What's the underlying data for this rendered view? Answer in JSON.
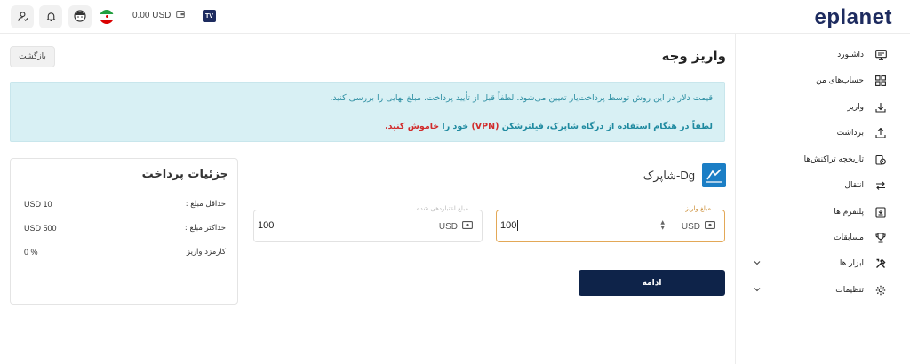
{
  "brand": {
    "logo": "eplanet"
  },
  "topbar": {
    "balance": "0.00 USD",
    "tv_label": "TV",
    "icons": [
      "tv-icon",
      "wallet-icon",
      "iran-flag-icon",
      "support-avatar-icon",
      "bell-icon",
      "user-icon"
    ]
  },
  "sidebar": {
    "items": [
      {
        "label": "داشبورد",
        "icon": "monitor-icon"
      },
      {
        "label": "حساب‌های من",
        "icon": "grid-icon"
      },
      {
        "label": "واریز",
        "icon": "download-icon"
      },
      {
        "label": "برداشت",
        "icon": "upload-icon"
      },
      {
        "label": "تاریخچه تراکنش‌ها",
        "icon": "history-icon"
      },
      {
        "label": "انتقال",
        "icon": "transfer-icon"
      },
      {
        "label": "پلتفرم ها",
        "icon": "platform-icon"
      },
      {
        "label": "مسابقات",
        "icon": "trophy-icon"
      },
      {
        "label": "ابزار ها",
        "icon": "tools-icon",
        "expandable": true
      },
      {
        "label": "تنظیمات",
        "icon": "gear-icon",
        "expandable": true
      }
    ]
  },
  "main": {
    "title": "واریز وجه",
    "back_label": "بازگشت",
    "alert": {
      "line1": "قیمت دلار در این روش توسط پرداخت‌یار تعیین می‌شود. لطفاً قبل از تأیید پرداخت، مبلغ نهایی را بررسی کنید.",
      "line2_a": "لطفاً در هنگام استفاده از درگاه شاپرک، فیلترشکن ",
      "line2_vpn": "(VPN)",
      "line2_b": " خود را ",
      "line2_off": "خاموش کنید."
    },
    "gateway": {
      "name": "Dg-شاپرک"
    },
    "amount_field": {
      "label": "مبلغ واریز",
      "value": "100",
      "currency": "USD"
    },
    "credit_field": {
      "label": "مبلغ اعتبار‌دهی شده",
      "value": "100",
      "currency": "USD"
    },
    "submit_label": "ادامه"
  },
  "details": {
    "title": "جزئیات پرداخت",
    "rows": [
      {
        "label": "حداقل مبلغ :",
        "value": "USD 10"
      },
      {
        "label": "حداکثر مبلغ :",
        "value": "USD 500"
      },
      {
        "label": "کارمزد واریز",
        "value": "0 %"
      }
    ]
  },
  "colors": {
    "brand_navy": "#0e2349",
    "alert_bg": "#d8f0f4",
    "alert_text": "#2e8fa3",
    "warning_red": "#d12c2c",
    "input_focus": "#e3a857"
  }
}
